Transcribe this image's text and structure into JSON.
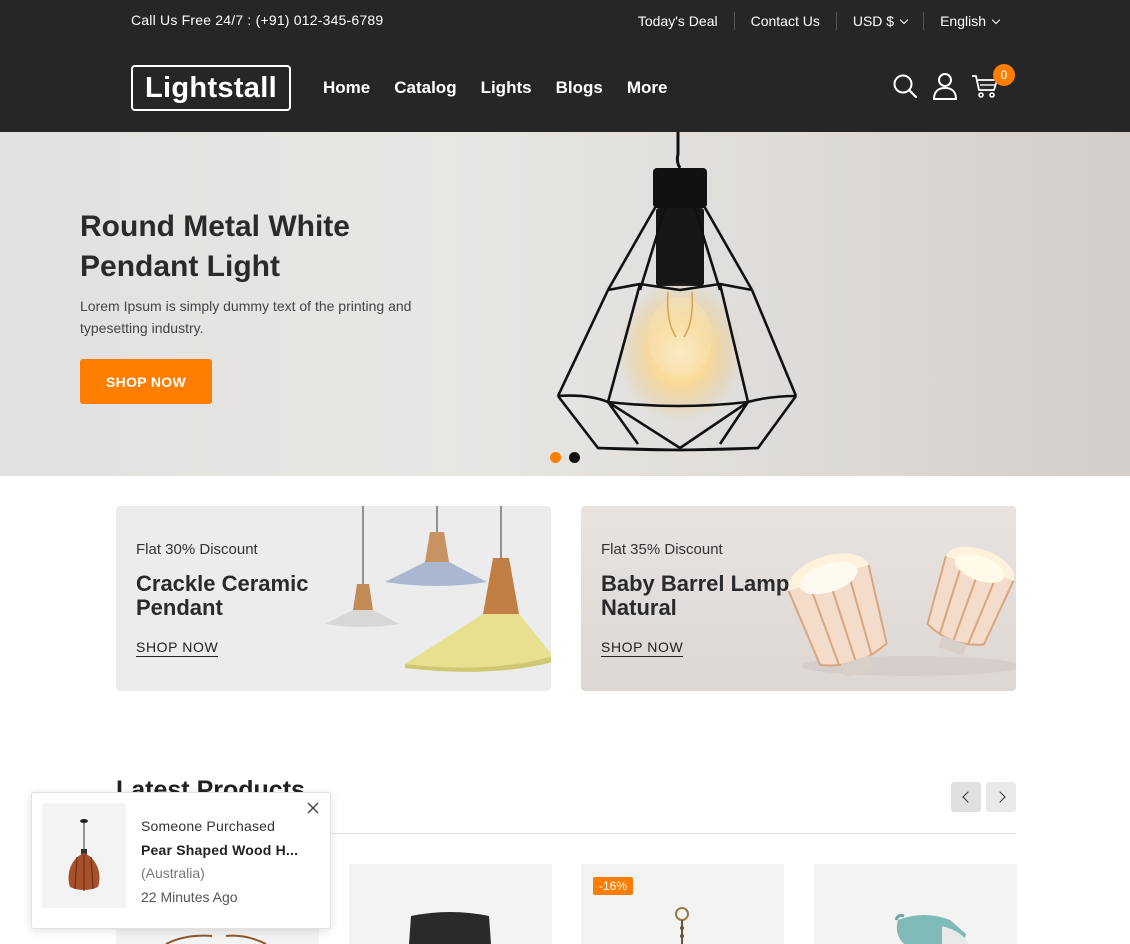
{
  "topbar": {
    "phone_text": "Call Us Free 24/7 : (+91) 012-345-6789",
    "links": [
      "Today's Deal",
      "Contact Us"
    ],
    "currency": "USD $",
    "language": "English"
  },
  "header": {
    "logo": "Lightstall",
    "nav": [
      "Home",
      "Catalog",
      "Lights",
      "Blogs",
      "More"
    ],
    "cart_count": "0",
    "icons": [
      "search-icon",
      "user-icon",
      "cart-icon"
    ]
  },
  "hero": {
    "title": "Round Metal White Pendant Light",
    "description": "Lorem Ipsum is simply dummy text of the printing and typesetting industry.",
    "button": "SHOP NOW",
    "slides": 2,
    "active_slide": 1
  },
  "banners": [
    {
      "subtitle": "Flat 30% Discount",
      "title": "Crackle Ceramic Pendant",
      "link": "SHOP NOW"
    },
    {
      "subtitle": "Flat 35% Discount",
      "title": "Baby Barrel Lamp Natural",
      "link": "SHOP NOW"
    }
  ],
  "latest": {
    "heading": "Latest Products",
    "products": [
      {
        "badge": ""
      },
      {
        "badge": ""
      },
      {
        "badge": "-16%"
      },
      {
        "badge": ""
      }
    ]
  },
  "popup": {
    "line1": "Someone Purchased",
    "product": "Pear Shaped Wood H...",
    "location": "(Australia)",
    "time": "22 Minutes Ago"
  },
  "colors": {
    "accent": "#ff7d00",
    "header_bg": "#262626"
  }
}
